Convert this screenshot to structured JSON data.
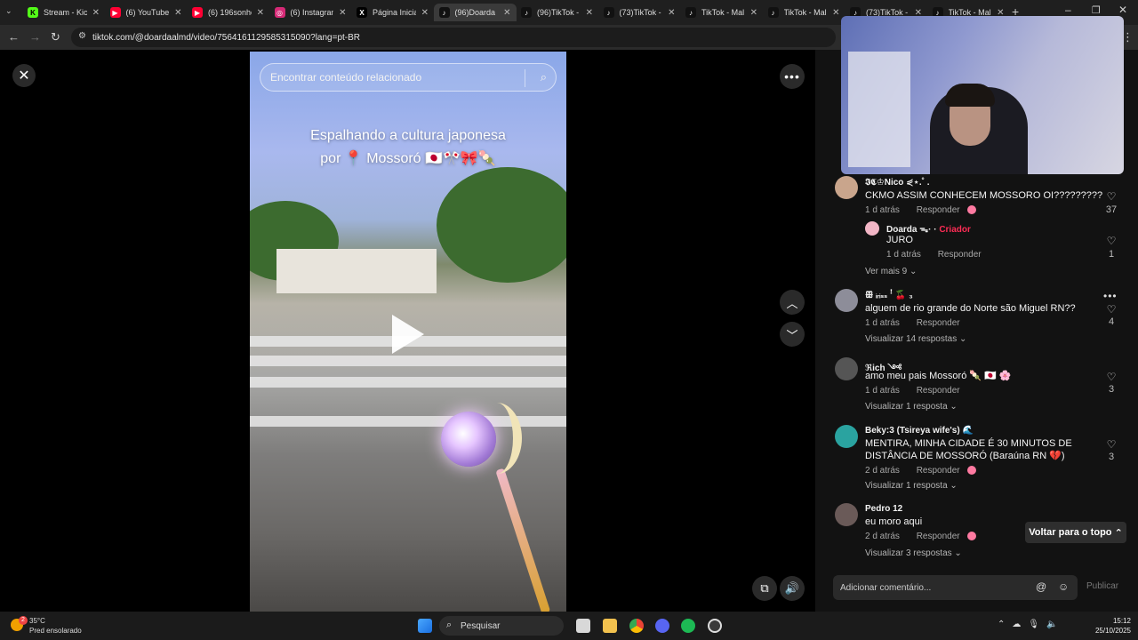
{
  "browser": {
    "tabs": [
      {
        "label": "Stream - Kick",
        "favicon": "kick-icon",
        "color": "#53fc18",
        "glyph": "K"
      },
      {
        "label": "(6) YouTube",
        "favicon": "youtube-icon",
        "color": "#ff0033",
        "glyph": "▶"
      },
      {
        "label": "(6) 196sonhe",
        "favicon": "youtube-icon",
        "color": "#ff0033",
        "glyph": "▶"
      },
      {
        "label": "(6) Instagram",
        "favicon": "instagram-icon",
        "color": "#d62976",
        "glyph": "◎"
      },
      {
        "label": "Página Inicial",
        "favicon": "x-icon",
        "color": "#000000",
        "glyph": "X"
      },
      {
        "label": "(96)Doarda",
        "favicon": "tiktok-icon",
        "color": "#111111",
        "glyph": "♪"
      },
      {
        "label": "(96)TikTok -",
        "favicon": "tiktok-icon",
        "color": "#111111",
        "glyph": "♪"
      },
      {
        "label": "(73)TikTok -",
        "favicon": "tiktok-icon",
        "color": "#111111",
        "glyph": "♪"
      },
      {
        "label": "TikTok - Mal",
        "favicon": "tiktok-icon",
        "color": "#111111",
        "glyph": "♪"
      },
      {
        "label": "TikTok - Mal",
        "favicon": "tiktok-icon",
        "color": "#111111",
        "glyph": "♪"
      },
      {
        "label": "(73)TikTok -",
        "favicon": "tiktok-icon",
        "color": "#111111",
        "glyph": "♪"
      },
      {
        "label": "TikTok - Mal",
        "favicon": "tiktok-icon",
        "color": "#111111",
        "glyph": "♪"
      }
    ],
    "active_tab": 5,
    "url": "tiktok.com/@doardaalmd/video/7564161129585315090?lang=pt-BR"
  },
  "video": {
    "search_placeholder": "Encontrar conteúdo relacionado",
    "caption_line1": "Espalhando a cultura japonesa",
    "caption_line2": "por 📍 Mossoró 🇯🇵🎌🎀🍡"
  },
  "comments": [
    {
      "user": "𝕴𝕮♔Nico ⋞⋆.˚ .",
      "text": "CKMO ASSIM CONHECEM MOSSORO OI?????????",
      "time": "1 d atrás",
      "reply": "Responder",
      "likes": "37",
      "heart": true,
      "avatar": "#c9a58c"
    },
    {
      "user": "Doarda ᯓ·",
      "creator": "Criador",
      "text": "JURO",
      "time": "1 d atrás",
      "reply": "Responder",
      "likes": "1",
      "avatar": "#f2b6c6"
    },
    {
      "user": "ꕥ ᵢᵣᵢₛₛ ꜝ 🍒 ₃",
      "text": "alguem de rio grande do Norte são Miguel RN??",
      "time": "1 d atrás",
      "reply": "Responder",
      "likes": "4",
      "avatar": "#8d8d99"
    },
    {
      "user": "ℜich ༺",
      "text": "amo meu pais Mossoró 🍡 🇯🇵 🌸",
      "time": "1 d atrás",
      "reply": "Responder",
      "likes": "3",
      "avatar": "#555555"
    },
    {
      "user": "Beky:3 (Tsireya wife's) 🌊",
      "text": "MENTIRA, MINHA CIDADE É 30 MINUTOS DE DISTÂNCIA DE MOSSORÓ (Baraúna RN 💔)",
      "time": "2 d atrás",
      "reply": "Responder",
      "likes": "3",
      "heart": true,
      "avatar": "#2aa3a0"
    },
    {
      "user": "Pedro 12",
      "text": "eu moro aqui",
      "time": "2 d atrás",
      "reply": "Responder",
      "heart": true,
      "avatar": "#6a5a58"
    }
  ],
  "replies_links": {
    "c0": "Ver mais 9",
    "c2": "Visualizar 14 respostas",
    "c3": "Visualizar 1 resposta",
    "c4": "Visualizar 1 resposta",
    "c5": "Visualizar 3 respostas"
  },
  "panel": {
    "back_to_top": "Voltar para o topo",
    "comment_placeholder": "Adicionar comentário...",
    "publish": "Publicar"
  },
  "taskbar": {
    "weather_temp": "35°C",
    "weather_desc": "Pred ensolarado",
    "weather_badge": "2",
    "search": "Pesquisar",
    "time": "15:12",
    "date": "25/10/2025"
  },
  "colors": {
    "accent": "#fe2c55",
    "panel_bg": "#121212"
  }
}
